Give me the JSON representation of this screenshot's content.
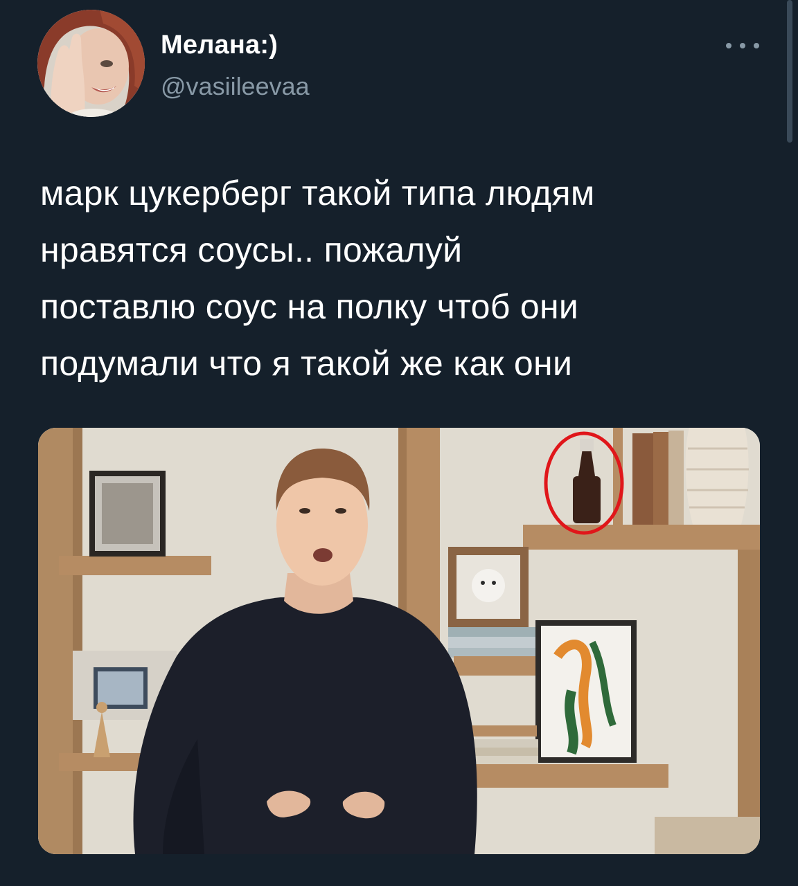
{
  "tweet": {
    "display_name": "Мелана:)",
    "handle": "@vasiileevaa",
    "text": "марк цукерберг такой типа людям\nнравятся соусы.. пожалуй\nпоставлю соус на полку чтоб они\nподумали что я такой же как они"
  },
  "icons": {
    "more": "more-horizontal-icon"
  },
  "colors": {
    "background": "#15202b",
    "text": "#ffffff",
    "secondary_text": "#8899a6",
    "annotation_circle": "#e0161a"
  }
}
